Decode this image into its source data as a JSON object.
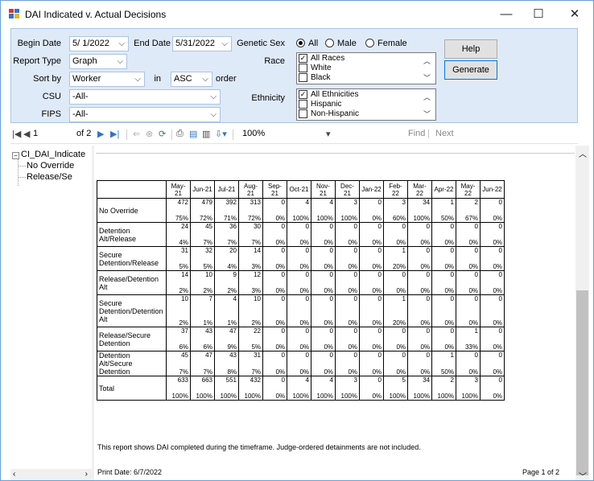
{
  "window": {
    "title": "DAI Indicated v. Actual Decisions",
    "minimize": "—",
    "maximize": "☐",
    "close": "✕"
  },
  "form": {
    "begin_date_label": "Begin Date",
    "begin_date_value": "5/ 1/2022",
    "end_date_label": "End Date",
    "end_date_value": "5/31/2022",
    "report_type_label": "Report Type",
    "report_type_value": "Graph",
    "sort_by_label": "Sort by",
    "sort_by_value": "Worker",
    "in_label": "in",
    "order_value": "ASC",
    "order_label": "order",
    "csu_label": "CSU",
    "csu_value": "-All-",
    "fips_label": "FIPS",
    "fips_value": "-All-",
    "genetic_sex_label": "Genetic Sex",
    "sex_options": [
      {
        "label": "All",
        "selected": true
      },
      {
        "label": "Male",
        "selected": false
      },
      {
        "label": "Female",
        "selected": false
      }
    ],
    "race_label": "Race",
    "race_options": [
      {
        "label": "All Races",
        "checked": true
      },
      {
        "label": "White",
        "checked": false
      },
      {
        "label": "Black",
        "checked": false
      }
    ],
    "ethnicity_label": "Ethnicity",
    "ethnicity_options": [
      {
        "label": "All Ethnicities",
        "checked": true
      },
      {
        "label": "Hispanic",
        "checked": false
      },
      {
        "label": "Non-Hispanic",
        "checked": false
      }
    ],
    "help_label": "Help",
    "generate_label": "Generate"
  },
  "toolbar": {
    "page_current": "1",
    "page_of": "of 2",
    "zoom": "100%",
    "find_label": "Find",
    "separator": "|",
    "next_label": "Next"
  },
  "tree": {
    "root": "CI_DAI_Indicate",
    "children": [
      "No Override",
      "Release/Se"
    ]
  },
  "report": {
    "columns": [
      "May-21",
      "Jun-21",
      "Jul-21",
      "Aug-21",
      "Sep-21",
      "Oct-21",
      "Nov-21",
      "Dec-21",
      "Jan-22",
      "Feb-22",
      "Mar-22",
      "Apr-22",
      "May-22",
      "Jun-22"
    ],
    "rows": [
      {
        "label": "No Override",
        "counts": [
          "472",
          "479",
          "392",
          "313",
          "0",
          "4",
          "4",
          "3",
          "0",
          "3",
          "34",
          "1",
          "2",
          "0"
        ],
        "pcts": [
          "75%",
          "72%",
          "71%",
          "72%",
          "0%",
          "100%",
          "100%",
          "100%",
          "0%",
          "60%",
          "100%",
          "50%",
          "67%",
          "0%"
        ]
      },
      {
        "label": "Detention Alt/Release",
        "counts": [
          "24",
          "45",
          "36",
          "30",
          "0",
          "0",
          "0",
          "0",
          "0",
          "0",
          "0",
          "0",
          "0",
          "0"
        ],
        "pcts": [
          "4%",
          "7%",
          "7%",
          "7%",
          "0%",
          "0%",
          "0%",
          "0%",
          "0%",
          "0%",
          "0%",
          "0%",
          "0%",
          "0%"
        ]
      },
      {
        "label": "Secure Detention/Release",
        "counts": [
          "31",
          "32",
          "20",
          "14",
          "0",
          "0",
          "0",
          "0",
          "0",
          "1",
          "0",
          "0",
          "0",
          "0"
        ],
        "pcts": [
          "5%",
          "5%",
          "4%",
          "3%",
          "0%",
          "0%",
          "0%",
          "0%",
          "0%",
          "20%",
          "0%",
          "0%",
          "0%",
          "0%"
        ]
      },
      {
        "label": "Release/Detention Alt",
        "counts": [
          "14",
          "10",
          "9",
          "12",
          "0",
          "0",
          "0",
          "0",
          "0",
          "0",
          "0",
          "0",
          "0",
          "0"
        ],
        "pcts": [
          "2%",
          "2%",
          "2%",
          "3%",
          "0%",
          "0%",
          "0%",
          "0%",
          "0%",
          "0%",
          "0%",
          "0%",
          "0%",
          "0%"
        ]
      },
      {
        "label": "Secure Detention/Detention Alt",
        "counts": [
          "10",
          "7",
          "4",
          "10",
          "0",
          "0",
          "0",
          "0",
          "0",
          "1",
          "0",
          "0",
          "0",
          "0"
        ],
        "pcts": [
          "2%",
          "1%",
          "1%",
          "2%",
          "0%",
          "0%",
          "0%",
          "0%",
          "0%",
          "20%",
          "0%",
          "0%",
          "0%",
          "0%"
        ]
      },
      {
        "label": "Release/Secure Detention",
        "counts": [
          "37",
          "43",
          "47",
          "22",
          "0",
          "0",
          "0",
          "0",
          "0",
          "0",
          "0",
          "0",
          "1",
          "0"
        ],
        "pcts": [
          "6%",
          "6%",
          "9%",
          "5%",
          "0%",
          "0%",
          "0%",
          "0%",
          "0%",
          "0%",
          "0%",
          "0%",
          "33%",
          "0%"
        ]
      },
      {
        "label": "Detention Alt/Secure Detention",
        "counts": [
          "45",
          "47",
          "43",
          "31",
          "0",
          "0",
          "0",
          "0",
          "0",
          "0",
          "0",
          "1",
          "0",
          "0"
        ],
        "pcts": [
          "7%",
          "7%",
          "8%",
          "7%",
          "0%",
          "0%",
          "0%",
          "0%",
          "0%",
          "0%",
          "0%",
          "50%",
          "0%",
          "0%"
        ]
      },
      {
        "label": "Total",
        "counts": [
          "633",
          "663",
          "551",
          "432",
          "0",
          "4",
          "4",
          "3",
          "0",
          "5",
          "34",
          "2",
          "3",
          "0"
        ],
        "pcts": [
          "100%",
          "100%",
          "100%",
          "100%",
          "0%",
          "100%",
          "100%",
          "100%",
          "0%",
          "100%",
          "100%",
          "100%",
          "100%",
          "0%"
        ]
      }
    ],
    "note": "This report shows DAI completed during the timeframe. Judge-ordered detainments are not included.",
    "print_date": "Print Date: 6/7/2022",
    "page_label": "Page 1 of 2"
  }
}
